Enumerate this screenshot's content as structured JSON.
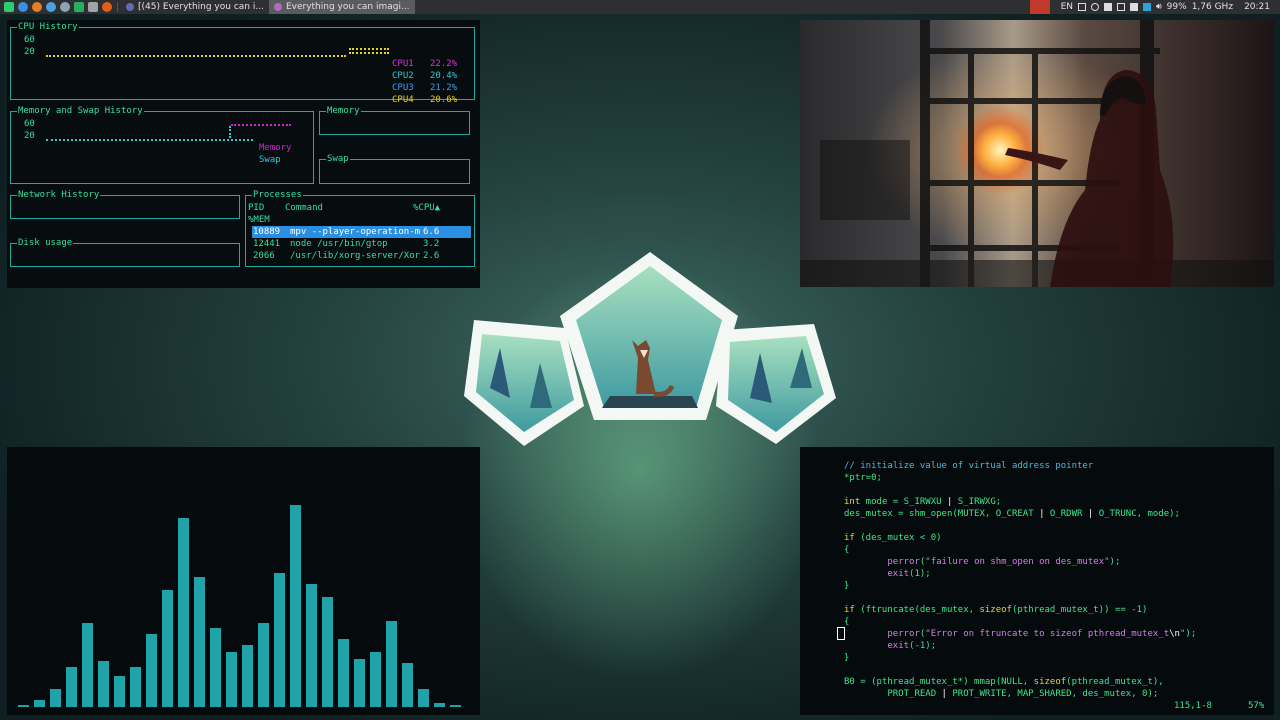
{
  "taskbar": {
    "tasks": [
      {
        "label": "[(45) Everything you can i..."
      },
      {
        "label": "Everything you can imagi..."
      }
    ],
    "tray": {
      "lang": "EN",
      "battery": "99%",
      "cpu_freq": "1,76 GHz",
      "clock": "20:21"
    }
  },
  "conky": {
    "cpu_history": {
      "title": "CPU History",
      "ticks": [
        "60",
        "20"
      ],
      "cores": [
        {
          "name": "CPU1",
          "value": "22.2%",
          "color": "#d020d0"
        },
        {
          "name": "CPU2",
          "value": "20.4%",
          "color": "#30c8d8"
        },
        {
          "name": "CPU3",
          "value": "21.2%",
          "color": "#3aa0ff"
        },
        {
          "name": "CPU4",
          "value": "20.6%",
          "color": "#e8d020"
        }
      ]
    },
    "mem_history": {
      "title": "Memory and Swap History",
      "ticks": [
        "60",
        "20"
      ],
      "legend": [
        "Memory",
        "Swap"
      ]
    },
    "memory": {
      "title": "Memory"
    },
    "swap": {
      "title": "Swap"
    },
    "network": {
      "title": "Network History"
    },
    "disk": {
      "title": "Disk usage"
    },
    "processes": {
      "title": "Processes",
      "headers": {
        "pid": "PID",
        "command": "Command",
        "cpu": "%CPU▲",
        "mem": "%MEM"
      },
      "rows": [
        {
          "pid": "10889",
          "command": "mpv --player-operation-m",
          "cpu": "6.6"
        },
        {
          "pid": "12441",
          "command": "node /usr/bin/gtop",
          "cpu": "3.2"
        },
        {
          "pid": "2066",
          "command": "/usr/lib/xorg-server/Xor",
          "cpu": "2.6"
        }
      ]
    }
  },
  "visualizer": {
    "levels": [
      0.01,
      0.03,
      0.08,
      0.18,
      0.38,
      0.21,
      0.14,
      0.18,
      0.33,
      0.53,
      0.86,
      0.59,
      0.36,
      0.25,
      0.28,
      0.38,
      0.61,
      0.92,
      0.56,
      0.5,
      0.31,
      0.22,
      0.25,
      0.39,
      0.2,
      0.08,
      0.02,
      0.01
    ]
  },
  "editor": {
    "status_pos": "115,1-8",
    "status_pct": "57%"
  }
}
